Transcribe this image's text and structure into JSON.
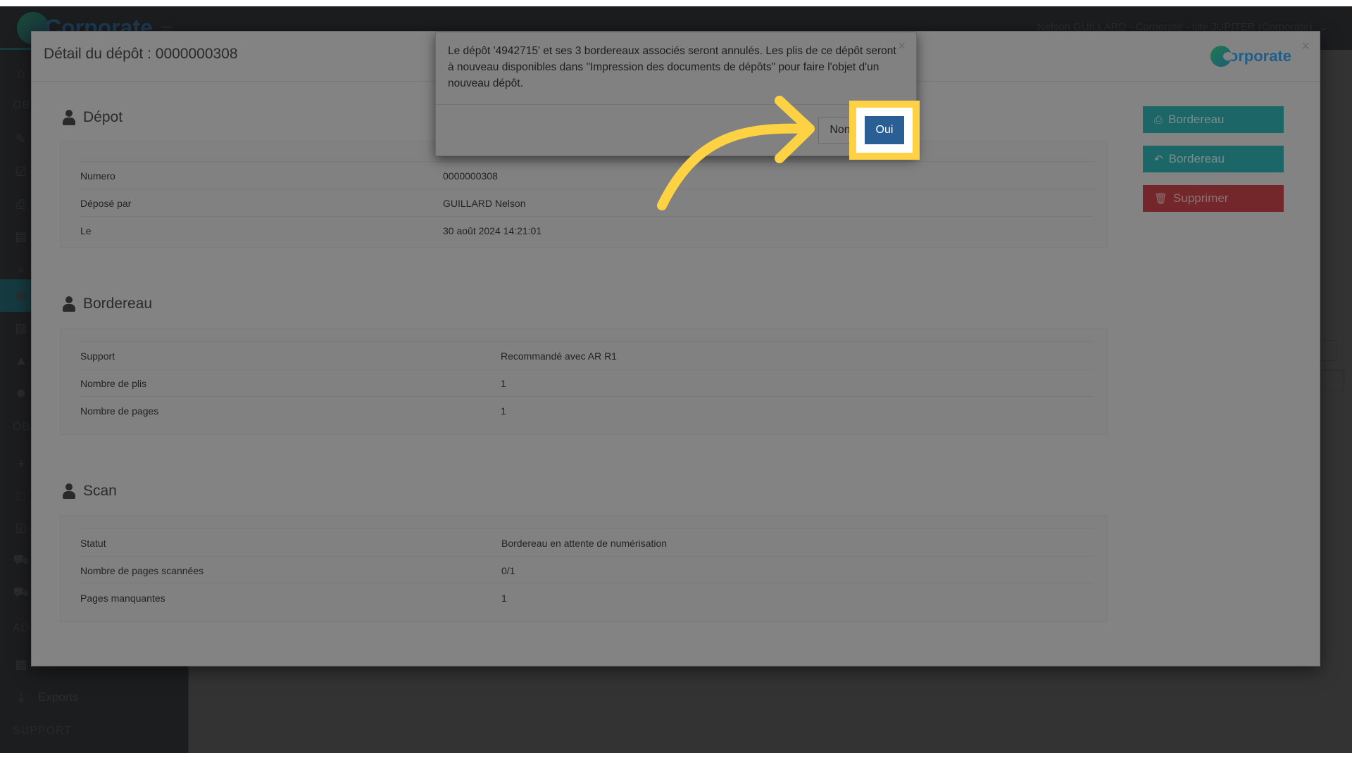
{
  "app": {
    "brand": "Corporate",
    "user_label": "Nelson GUILLARD - Corporate - site JUPITER (Corporate)",
    "sidebar": {
      "sections": [
        "OBJ",
        "OBJ",
        "ADM",
        "SUPPORT"
      ],
      "items": [
        {
          "icon": "home-icon"
        },
        {
          "icon": "pen-icon"
        },
        {
          "icon": "edit-icon"
        },
        {
          "icon": "print-icon"
        },
        {
          "icon": "document-icon"
        },
        {
          "icon": "search-icon"
        },
        {
          "icon": "calendar-icon",
          "active": true
        },
        {
          "icon": "barcode-icon"
        },
        {
          "icon": "alert-icon"
        },
        {
          "icon": "users-icon"
        },
        {
          "icon": "plus-icon"
        },
        {
          "icon": "square-icon"
        },
        {
          "icon": "checkbox-icon"
        },
        {
          "icon": "cart-icon"
        },
        {
          "icon": "truck-icon"
        },
        {
          "icon": "grid-icon"
        },
        {
          "icon": "download-icon",
          "label": "Exports"
        }
      ]
    }
  },
  "modal": {
    "title": "Détail du dépôt : 0000000308",
    "logo_text": "orporate",
    "close": "×",
    "sections": {
      "depot": {
        "title": "Dépot",
        "rows": [
          {
            "label": "Numero",
            "value": "0000000308"
          },
          {
            "label": "Déposé par",
            "value": "GUILLARD Nelson"
          },
          {
            "label": "Le",
            "value": "30 août 2024 14:21:01"
          }
        ]
      },
      "bordereau": {
        "title": "Bordereau",
        "rows": [
          {
            "label": "Support",
            "value": "Recommandé avec AR R1"
          },
          {
            "label": "Nombre de plis",
            "value": "1"
          },
          {
            "label": "Nombre de pages",
            "value": "1"
          }
        ]
      },
      "scan": {
        "title": "Scan",
        "rows": [
          {
            "label": "Statut",
            "value": "Bordereau en attente de numérisation"
          },
          {
            "label": "Nombre de pages scannées",
            "value": "0/1"
          },
          {
            "label": "Pages manquantes",
            "value": "1"
          }
        ]
      }
    },
    "actions": {
      "print_bordereau": "Bordereau",
      "reply_bordereau": "Bordereau",
      "delete": "Supprimer"
    }
  },
  "confirm": {
    "message": "Le dépôt '4942715' et ses 3 bordereaux associés seront annulés. Les plis de ce dépôt seront à nouveau disponibles dans \"Impression des documents de dépôts\" pour faire l'objet d'un nouveau dépôt.",
    "close": "×",
    "no_label": "Non",
    "yes_label": "Oui"
  },
  "annotation": {
    "highlight_color": "#ffd244",
    "target": "Oui"
  }
}
